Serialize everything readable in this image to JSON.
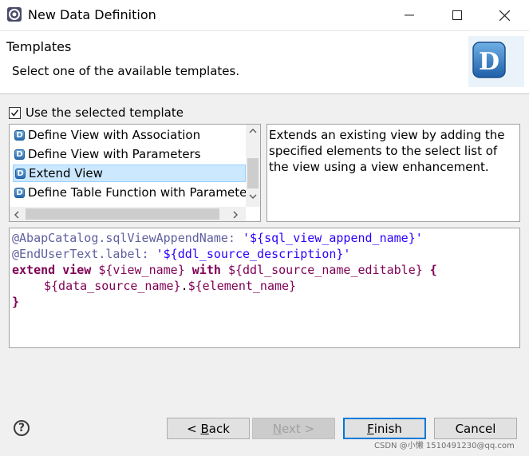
{
  "window": {
    "title": "New Data Definition"
  },
  "header": {
    "title": "Templates",
    "description": "Select one of the available templates.",
    "logo_letter": "D"
  },
  "use_template": {
    "label": "Use the selected template",
    "checked": true
  },
  "templates": {
    "items": [
      {
        "label": "Define View with Association",
        "selected": false
      },
      {
        "label": "Define View with Parameters",
        "selected": false
      },
      {
        "label": "Extend View",
        "selected": true
      },
      {
        "label": "Define Table Function with Parameters",
        "selected": false
      }
    ],
    "item_icon_letter": "D"
  },
  "template_description": "Extends an existing view by adding the specified elements to the select list of the view using a view enhancement.",
  "code": {
    "line1": {
      "anno": "@AbapCatalog.sqlViewAppendName: ",
      "str": "'${sql_view_append_name}'"
    },
    "line2": {
      "anno": "@EndUserText.label: ",
      "str": "'${ddl_source_description}'"
    },
    "line3": {
      "kw1": "extend view ",
      "ph1": "${view_name}",
      "kw2": " with ",
      "ph2": "${ddl_source_name_editable}",
      "tail": " {"
    },
    "line4": {
      "ph1": "${data_source_name}",
      "dot": ".",
      "ph2": "${element_name}"
    },
    "line5": {
      "brace": "}"
    }
  },
  "buttons": {
    "back": {
      "prefix": "< ",
      "mnemonic": "B",
      "rest": "ack"
    },
    "next": {
      "mnemonic": "N",
      "rest": "ext",
      "suffix": " >"
    },
    "finish": {
      "mnemonic": "F",
      "rest": "inish"
    },
    "cancel": {
      "label": "Cancel"
    }
  },
  "watermark": "CSDN @小懒 1510491230@qq.com",
  "colors": {
    "selection": "#cce8ff",
    "default_button_border": "#0078d7",
    "keyword": "#7f0055",
    "string": "#2a00ff"
  },
  "icons": [
    "app-icon",
    "minimize-icon",
    "maximize-icon",
    "close-icon",
    "ddl-logo-icon",
    "checkbox-check-icon",
    "ddl-template-icon",
    "scroll-up-icon",
    "scroll-down-icon",
    "scroll-left-icon",
    "scroll-right-icon",
    "help-icon"
  ]
}
